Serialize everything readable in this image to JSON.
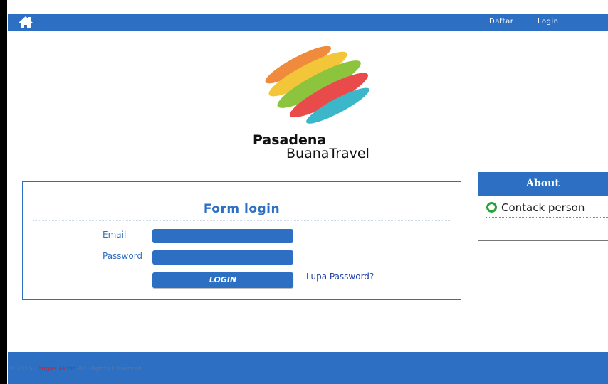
{
  "header": {
    "home_icon": "home-icon",
    "nav": [
      {
        "label": "Daftar"
      },
      {
        "label": "Login"
      }
    ]
  },
  "brand": {
    "line1": "Pasadena",
    "line2": "BuanaTravel"
  },
  "login_form": {
    "title": "Form login",
    "email_label": "Email",
    "email_value": "",
    "password_label": "Password",
    "password_value": "",
    "submit_label": "LOGIN",
    "forgot_label": "Lupa Password?"
  },
  "about": {
    "title": "About",
    "items": [
      {
        "label": "Contack person",
        "icon": "ring-icon"
      }
    ]
  },
  "footer": {
    "prefix": "© 2015 |",
    "highlight": "tugas akhir",
    "suffix": "All Rights Reserved |"
  },
  "colors": {
    "primary": "#2d6fc3",
    "accent_green": "#27a33a",
    "link": "#1a3fa8"
  }
}
